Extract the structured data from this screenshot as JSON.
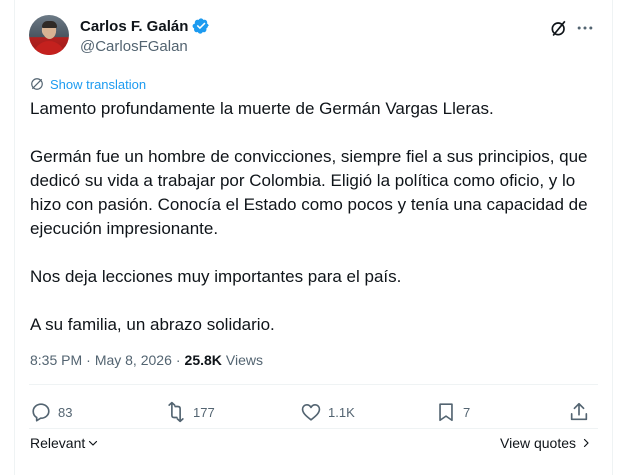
{
  "author": {
    "display_name": "Carlos F. Galán",
    "handle": "@CarlosFGalan",
    "verified": true
  },
  "translate_label": "Show translation",
  "tweet": {
    "paragraphs": [
      "Lamento profundamente la muerte de Germán Vargas Lleras.",
      "Germán fue un hombre de convicciones, siempre fiel a sus principios, que dedicó su vida a trabajar por Colombia. Eligió la política como oficio, y lo hizo con pasión. Conocía el Estado como pocos y tenía una capacidad de ejecución impresionante.",
      "Nos deja lecciones muy importantes para el país.",
      "A su familia, un abrazo solidario."
    ]
  },
  "meta": {
    "time": "8:35 PM",
    "separator": "·",
    "date": "May 8, 2026",
    "views_count": "25.8K",
    "views_label": "Views"
  },
  "actions": {
    "replies": "83",
    "reposts": "177",
    "likes": "1.1K",
    "bookmarks": "7"
  },
  "footer": {
    "sort_label": "Relevant",
    "view_quotes_label": "View quotes"
  },
  "colors": {
    "accent": "#1d9bf0",
    "text": "#0f1419",
    "muted": "#536471",
    "border": "#eff3f4"
  },
  "icons": [
    "verified-badge-icon",
    "grok-icon",
    "more-icon",
    "translate-icon",
    "reply-icon",
    "repost-icon",
    "like-icon",
    "bookmark-icon",
    "share-icon",
    "chevron-down-icon",
    "chevron-right-icon"
  ]
}
